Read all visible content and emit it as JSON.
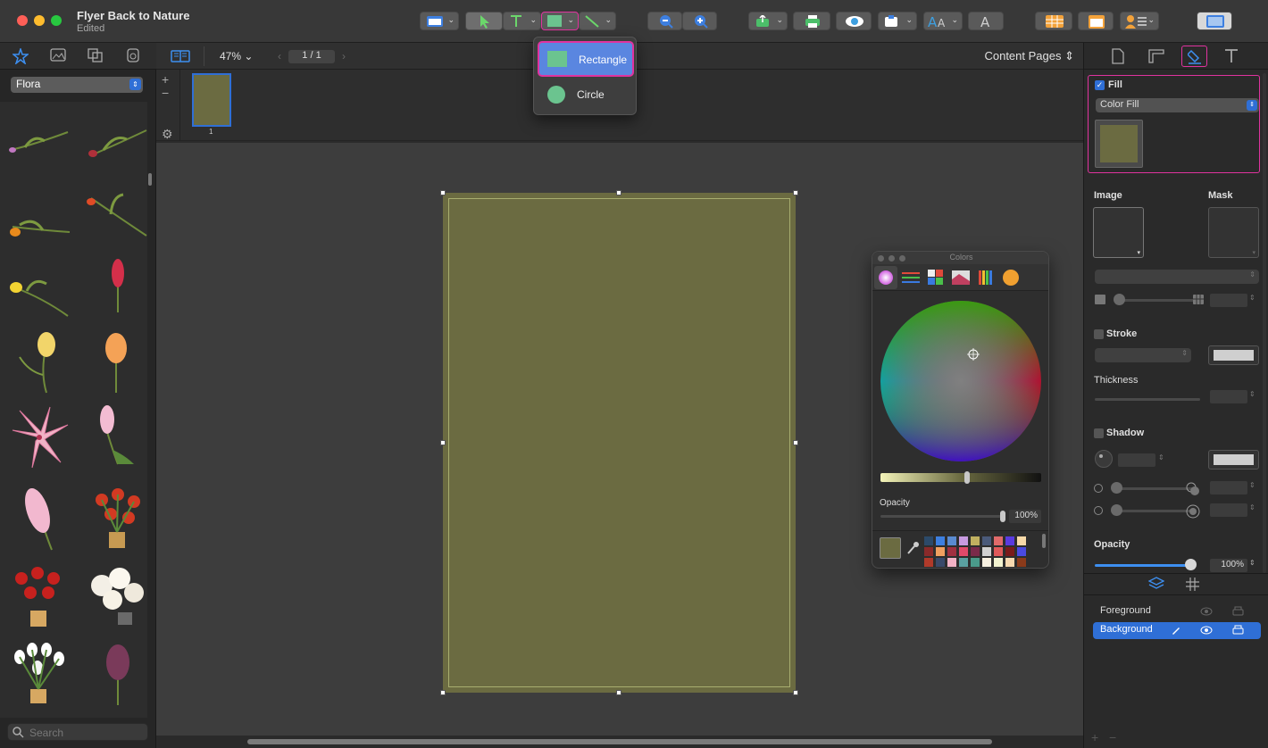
{
  "window": {
    "title": "Flyer Back to Nature",
    "subtitle": "Edited"
  },
  "toolbar": {
    "items": [
      "layout-icon",
      "pointer-icon",
      "text-icon",
      "rectangle-icon",
      "line-icon",
      "zoom-out-icon",
      "zoom-in-icon",
      "export-icon",
      "print-icon",
      "preview-icon",
      "insert-icon",
      "fonts-icon",
      "text-style-icon",
      "spreadsheet-icon",
      "calendar-icon",
      "contacts-icon",
      "sidebar-icon"
    ]
  },
  "shape_menu": {
    "items": [
      {
        "label": "Rectangle",
        "selected": true,
        "color": "#6bc48f"
      },
      {
        "label": "Circle",
        "selected": false,
        "color": "#6bc48f"
      }
    ]
  },
  "subbar": {
    "zoom": "47%",
    "page": "1 / 1",
    "view": "Content Pages"
  },
  "library": {
    "category": "Flora",
    "search_placeholder": "Search"
  },
  "thumbnail": {
    "number": "1"
  },
  "page": {
    "fill_color": "#6b6b41"
  },
  "inspector": {
    "fill": {
      "label": "Fill",
      "checked": true,
      "type": "Color Fill",
      "swatch": "#6b6b41"
    },
    "image_label": "Image",
    "mask_label": "Mask",
    "stroke_label": "Stroke",
    "thickness_label": "Thickness",
    "shadow_label": "Shadow",
    "opacity_label": "Opacity",
    "opacity_value": "100%"
  },
  "colors_panel": {
    "title": "Colors",
    "opacity_label": "Opacity",
    "opacity_value": "100%",
    "current": "#6b6b41"
  },
  "layers": [
    {
      "name": "Foreground",
      "selected": false
    },
    {
      "name": "Background",
      "selected": true
    }
  ]
}
